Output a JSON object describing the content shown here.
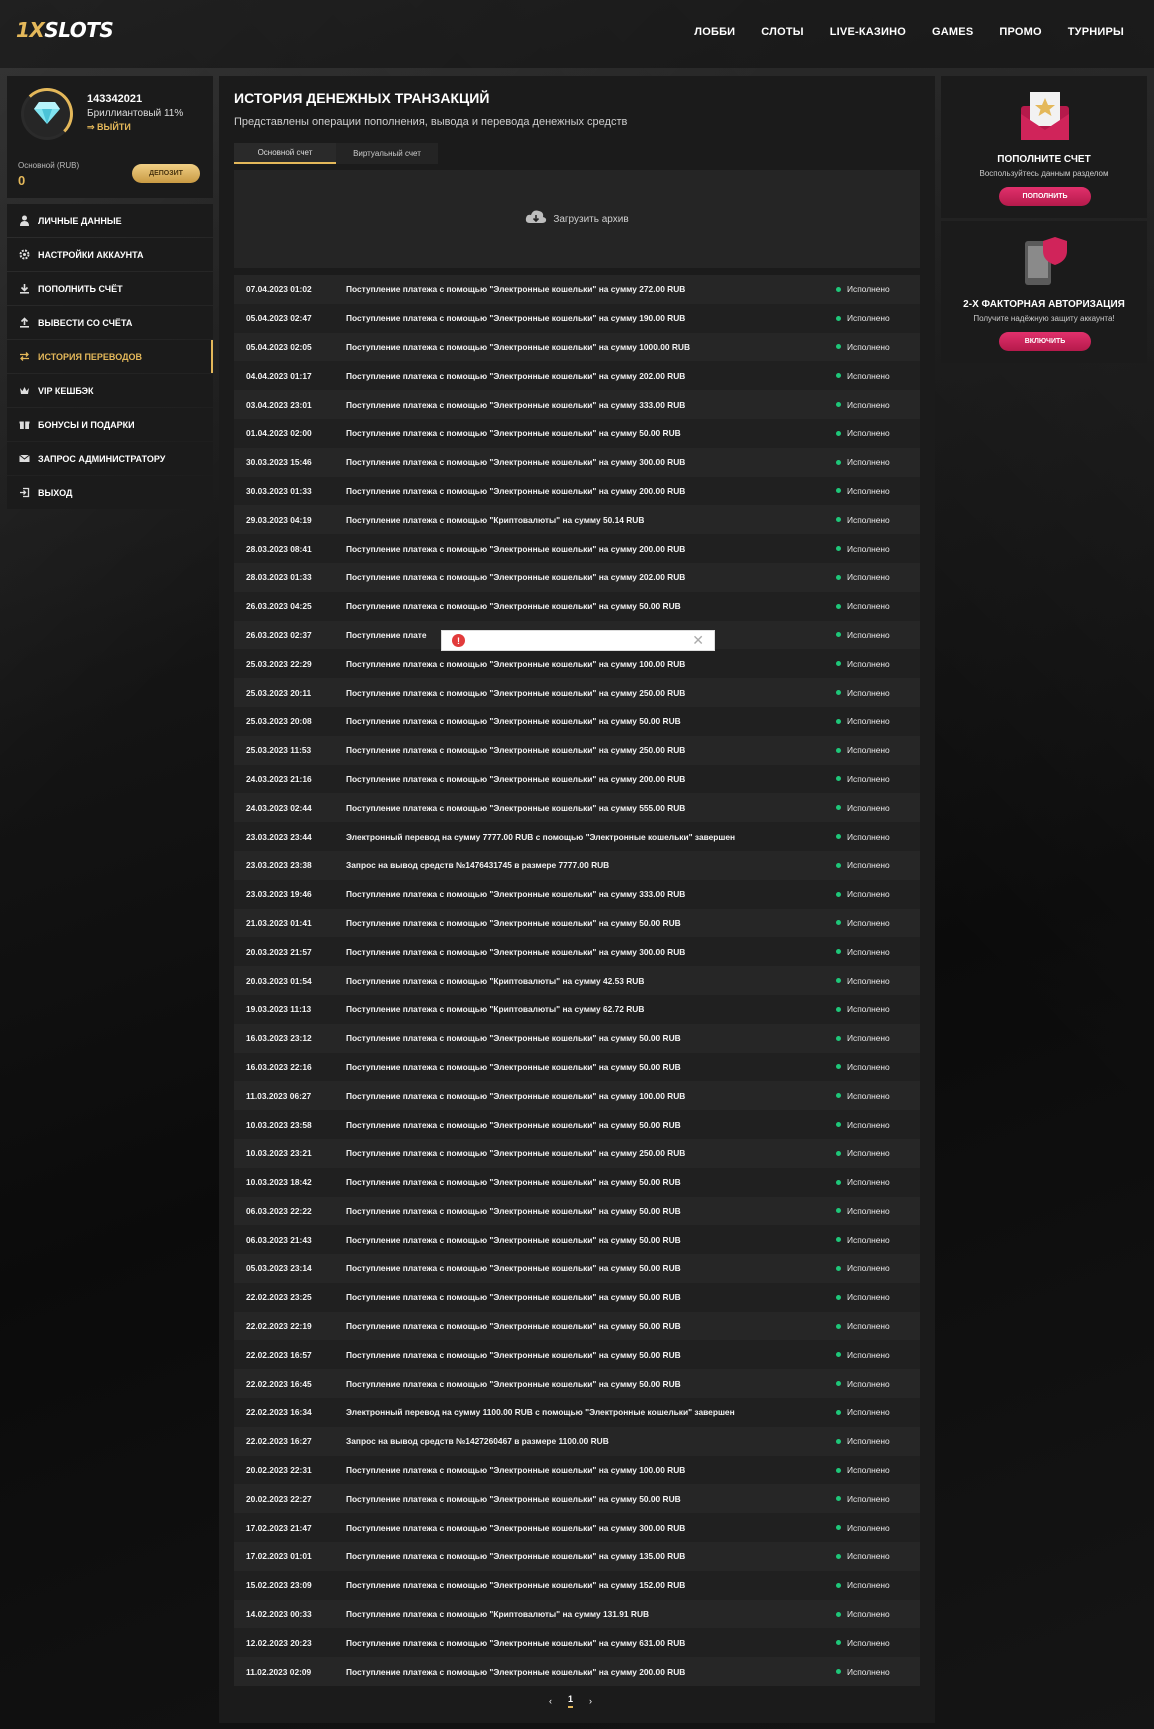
{
  "header": {
    "logo_part1": "1X",
    "logo_part2": "SLOTS",
    "nav": [
      "ЛОББИ",
      "СЛОТЫ",
      "LIVE-КАЗИНО",
      "GAMES",
      "ПРОМО",
      "ТУРНИРЫ"
    ]
  },
  "profile": {
    "user_id": "143342021",
    "level": "Бриллиантовый 11%",
    "logout": "ВЫЙТИ",
    "balance_label": "Основной (RUB)",
    "balance_value": "0",
    "deposit_button": "ДЕПОЗИТ"
  },
  "menu": [
    {
      "label": "ЛИЧНЫЕ ДАННЫЕ",
      "icon": "user-icon"
    },
    {
      "label": "НАСТРОЙКИ АККАУНТА",
      "icon": "gear-icon"
    },
    {
      "label": "ПОПОЛНИТЬ СЧЁТ",
      "icon": "download-icon"
    },
    {
      "label": "ВЫВЕСТИ СО СЧЁТА",
      "icon": "upload-icon"
    },
    {
      "label": "ИСТОРИЯ ПЕРЕВОДОВ",
      "icon": "transfer-icon"
    },
    {
      "label": "VIP КЕШБЭК",
      "icon": "crown-icon"
    },
    {
      "label": "БОНУСЫ И ПОДАРКИ",
      "icon": "gift-icon"
    },
    {
      "label": "ЗАПРОС АДМИНИСТРАТОРУ",
      "icon": "mail-icon"
    },
    {
      "label": "ВЫХОД",
      "icon": "exit-icon"
    }
  ],
  "main": {
    "title": "ИСТОРИЯ ДЕНЕЖНЫХ ТРАНЗАКЦИЙ",
    "subtitle": "Представлены операции пополнения, вывода и перевода денежных средств",
    "tabs": [
      "Основной счет",
      "Виртуальный счет"
    ],
    "archive_label": "Загрузить архив",
    "page": "1"
  },
  "transactions": [
    {
      "date": "07.04.2023 01:02",
      "desc": "Поступление платежа с помощью \"Электронные кошельки\" на сумму 272.00 RUB",
      "status": "Исполнено"
    },
    {
      "date": "05.04.2023 02:47",
      "desc": "Поступление платежа с помощью \"Электронные кошельки\" на сумму 190.00 RUB",
      "status": "Исполнено"
    },
    {
      "date": "05.04.2023 02:05",
      "desc": "Поступление платежа с помощью \"Электронные кошельки\" на сумму 1000.00 RUB",
      "status": "Исполнено"
    },
    {
      "date": "04.04.2023 01:17",
      "desc": "Поступление платежа с помощью \"Электронные кошельки\" на сумму 202.00 RUB",
      "status": "Исполнено"
    },
    {
      "date": "03.04.2023 23:01",
      "desc": "Поступление платежа с помощью \"Электронные кошельки\" на сумму 333.00 RUB",
      "status": "Исполнено"
    },
    {
      "date": "01.04.2023 02:00",
      "desc": "Поступление платежа с помощью \"Электронные кошельки\" на сумму 50.00 RUB",
      "status": "Исполнено"
    },
    {
      "date": "30.03.2023 15:46",
      "desc": "Поступление платежа с помощью \"Электронные кошельки\" на сумму 300.00 RUB",
      "status": "Исполнено"
    },
    {
      "date": "30.03.2023 01:33",
      "desc": "Поступление платежа с помощью \"Электронные кошельки\" на сумму 200.00 RUB",
      "status": "Исполнено"
    },
    {
      "date": "29.03.2023 04:19",
      "desc": "Поступление платежа с помощью \"Криптовалюты\" на сумму 50.14 RUB",
      "status": "Исполнено"
    },
    {
      "date": "28.03.2023 08:41",
      "desc": "Поступление платежа с помощью \"Электронные кошельки\" на сумму 200.00 RUB",
      "status": "Исполнено"
    },
    {
      "date": "28.03.2023 01:33",
      "desc": "Поступление платежа с помощью \"Электронные кошельки\" на сумму 202.00 RUB",
      "status": "Исполнено"
    },
    {
      "date": "26.03.2023 04:25",
      "desc": "Поступление платежа с помощью \"Электронные кошельки\" на сумму 50.00 RUB",
      "status": "Исполнено"
    },
    {
      "date": "26.03.2023 02:37",
      "desc": "Поступление плате",
      "status": "Исполнено"
    },
    {
      "date": "25.03.2023 22:29",
      "desc": "Поступление платежа с помощью \"Электронные кошельки\" на сумму 100.00 RUB",
      "status": "Исполнено"
    },
    {
      "date": "25.03.2023 20:11",
      "desc": "Поступление платежа с помощью \"Электронные кошельки\" на сумму 250.00 RUB",
      "status": "Исполнено"
    },
    {
      "date": "25.03.2023 20:08",
      "desc": "Поступление платежа с помощью \"Электронные кошельки\" на сумму 50.00 RUB",
      "status": "Исполнено"
    },
    {
      "date": "25.03.2023 11:53",
      "desc": "Поступление платежа с помощью \"Электронные кошельки\" на сумму 250.00 RUB",
      "status": "Исполнено"
    },
    {
      "date": "24.03.2023 21:16",
      "desc": "Поступление платежа с помощью \"Электронные кошельки\" на сумму 200.00 RUB",
      "status": "Исполнено"
    },
    {
      "date": "24.03.2023 02:44",
      "desc": "Поступление платежа с помощью \"Электронные кошельки\" на сумму 555.00 RUB",
      "status": "Исполнено"
    },
    {
      "date": "23.03.2023 23:44",
      "desc": "Электронный перевод на сумму 7777.00 RUB с помощью \"Электронные кошельки\" завершен",
      "status": "Исполнено"
    },
    {
      "date": "23.03.2023 23:38",
      "desc": "Запрос на вывод средств №1476431745 в размере 7777.00 RUB",
      "status": "Исполнено"
    },
    {
      "date": "23.03.2023 19:46",
      "desc": "Поступление платежа с помощью \"Электронные кошельки\" на сумму 333.00 RUB",
      "status": "Исполнено"
    },
    {
      "date": "21.03.2023 01:41",
      "desc": "Поступление платежа с помощью \"Электронные кошельки\" на сумму 50.00 RUB",
      "status": "Исполнено"
    },
    {
      "date": "20.03.2023 21:57",
      "desc": "Поступление платежа с помощью \"Электронные кошельки\" на сумму 300.00 RUB",
      "status": "Исполнено"
    },
    {
      "date": "20.03.2023 01:54",
      "desc": "Поступление платежа с помощью \"Криптовалюты\" на сумму 42.53 RUB",
      "status": "Исполнено"
    },
    {
      "date": "19.03.2023 11:13",
      "desc": "Поступление платежа с помощью \"Криптовалюты\" на сумму 62.72 RUB",
      "status": "Исполнено"
    },
    {
      "date": "16.03.2023 23:12",
      "desc": "Поступление платежа с помощью \"Электронные кошельки\" на сумму 50.00 RUB",
      "status": "Исполнено"
    },
    {
      "date": "16.03.2023 22:16",
      "desc": "Поступление платежа с помощью \"Электронные кошельки\" на сумму 50.00 RUB",
      "status": "Исполнено"
    },
    {
      "date": "11.03.2023 06:27",
      "desc": "Поступление платежа с помощью \"Электронные кошельки\" на сумму 100.00 RUB",
      "status": "Исполнено"
    },
    {
      "date": "10.03.2023 23:58",
      "desc": "Поступление платежа с помощью \"Электронные кошельки\" на сумму 50.00 RUB",
      "status": "Исполнено"
    },
    {
      "date": "10.03.2023 23:21",
      "desc": "Поступление платежа с помощью \"Электронные кошельки\" на сумму 250.00 RUB",
      "status": "Исполнено"
    },
    {
      "date": "10.03.2023 18:42",
      "desc": "Поступление платежа с помощью \"Электронные кошельки\" на сумму 50.00 RUB",
      "status": "Исполнено"
    },
    {
      "date": "06.03.2023 22:22",
      "desc": "Поступление платежа с помощью \"Электронные кошельки\" на сумму 50.00 RUB",
      "status": "Исполнено"
    },
    {
      "date": "06.03.2023 21:43",
      "desc": "Поступление платежа с помощью \"Электронные кошельки\" на сумму 50.00 RUB",
      "status": "Исполнено"
    },
    {
      "date": "05.03.2023 23:14",
      "desc": "Поступление платежа с помощью \"Электронные кошельки\" на сумму 50.00 RUB",
      "status": "Исполнено"
    },
    {
      "date": "22.02.2023 23:25",
      "desc": "Поступление платежа с помощью \"Электронные кошельки\" на сумму 50.00 RUB",
      "status": "Исполнено"
    },
    {
      "date": "22.02.2023 22:19",
      "desc": "Поступление платежа с помощью \"Электронные кошельки\" на сумму 50.00 RUB",
      "status": "Исполнено"
    },
    {
      "date": "22.02.2023 16:57",
      "desc": "Поступление платежа с помощью \"Электронные кошельки\" на сумму 50.00 RUB",
      "status": "Исполнено"
    },
    {
      "date": "22.02.2023 16:45",
      "desc": "Поступление платежа с помощью \"Электронные кошельки\" на сумму 50.00 RUB",
      "status": "Исполнено"
    },
    {
      "date": "22.02.2023 16:34",
      "desc": "Электронный перевод на сумму 1100.00 RUB с помощью \"Электронные кошельки\" завершен",
      "status": "Исполнено"
    },
    {
      "date": "22.02.2023 16:27",
      "desc": "Запрос на вывод средств №1427260467 в размере 1100.00 RUB",
      "status": "Исполнено"
    },
    {
      "date": "20.02.2023 22:31",
      "desc": "Поступление платежа с помощью \"Электронные кошельки\" на сумму 100.00 RUB",
      "status": "Исполнено"
    },
    {
      "date": "20.02.2023 22:27",
      "desc": "Поступление платежа с помощью \"Электронные кошельки\" на сумму 50.00 RUB",
      "status": "Исполнено"
    },
    {
      "date": "17.02.2023 21:47",
      "desc": "Поступление платежа с помощью \"Электронные кошельки\" на сумму 300.00 RUB",
      "status": "Исполнено"
    },
    {
      "date": "17.02.2023 01:01",
      "desc": "Поступление платежа с помощью \"Электронные кошельки\" на сумму 135.00 RUB",
      "status": "Исполнено"
    },
    {
      "date": "15.02.2023 23:09",
      "desc": "Поступление платежа с помощью \"Электронные кошельки\" на сумму 152.00 RUB",
      "status": "Исполнено"
    },
    {
      "date": "14.02.2023 00:33",
      "desc": "Поступление платежа с помощью \"Криптовалюты\" на сумму 131.91 RUB",
      "status": "Исполнено"
    },
    {
      "date": "12.02.2023 20:23",
      "desc": "Поступление платежа с помощью \"Электронные кошельки\" на сумму 631.00 RUB",
      "status": "Исполнено"
    },
    {
      "date": "11.02.2023 02:09",
      "desc": "Поступление платежа с помощью \"Электронные кошельки\" на сумму 200.00 RUB",
      "status": "Исполнено"
    }
  ],
  "widgets": {
    "deposit": {
      "title": "ПОПОЛНИТЕ СЧЕТ",
      "text": "Воспользуйтесь данным разделом",
      "button": "ПОПОЛНИТЬ"
    },
    "twofa": {
      "title": "2-Х ФАКТОРНАЯ АВТОРИЗАЦИЯ",
      "text": "Получите надёжную защиту аккаунта!",
      "button": "ВКЛЮЧИТЬ"
    }
  },
  "colors": {
    "accent": "#e4b85a",
    "status_ok": "#1ec779",
    "cta": "#d0245a",
    "error": "#e23b3b"
  }
}
